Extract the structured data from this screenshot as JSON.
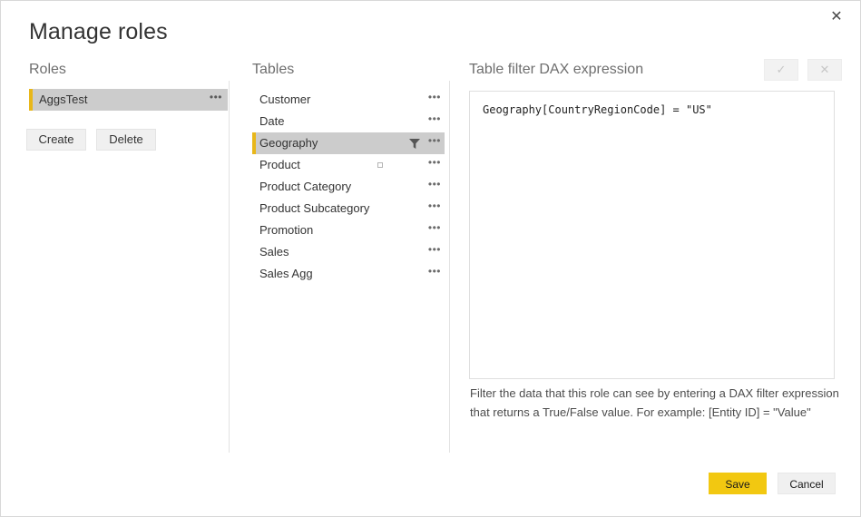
{
  "dialog": {
    "title": "Manage roles",
    "close_label": "✕",
    "close_icon": "close-icon"
  },
  "roles": {
    "heading": "Roles",
    "items": [
      {
        "label": "AggsTest",
        "selected": true,
        "ellipsis": "•••"
      }
    ],
    "create_label": "Create",
    "delete_label": "Delete"
  },
  "tables": {
    "heading": "Tables",
    "ellipsis": "•••",
    "items": [
      {
        "label": "Customer",
        "selected": false,
        "filtered": false,
        "marker": false
      },
      {
        "label": "Date",
        "selected": false,
        "filtered": false,
        "marker": false
      },
      {
        "label": "Geography",
        "selected": true,
        "filtered": true,
        "marker": false
      },
      {
        "label": "Product",
        "selected": false,
        "filtered": false,
        "marker": true
      },
      {
        "label": "Product Category",
        "selected": false,
        "filtered": false,
        "marker": false
      },
      {
        "label": "Product Subcategory",
        "selected": false,
        "filtered": false,
        "marker": false
      },
      {
        "label": "Promotion",
        "selected": false,
        "filtered": false,
        "marker": false
      },
      {
        "label": "Sales",
        "selected": false,
        "filtered": false,
        "marker": false
      },
      {
        "label": "Sales Agg",
        "selected": false,
        "filtered": false,
        "marker": false
      }
    ]
  },
  "dax": {
    "heading": "Table filter DAX expression",
    "accept_label": "✓",
    "reject_label": "✕",
    "expression": "Geography[CountryRegionCode] = \"US\"",
    "placeholder": "",
    "help_line_1": "Filter the data that this role can see by entering a DAX filter expression",
    "help_line_2": "that returns a True/False value. For example: [Entity ID] = \"Value\""
  },
  "footer": {
    "save_label": "Save",
    "cancel_label": "Cancel"
  },
  "colors": {
    "accent_yellow": "#e8b71a",
    "save_yellow": "#f2c811",
    "selection_gray": "#cccccc",
    "divider": "#e2e2e2"
  }
}
